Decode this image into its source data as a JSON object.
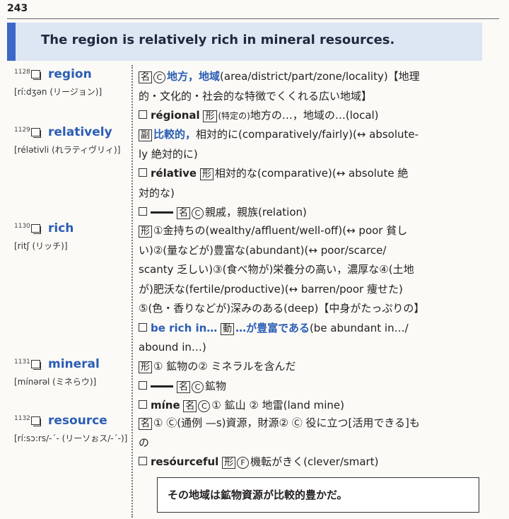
{
  "page_number": "243",
  "banner": {
    "sentence": "The region is relatively rich in mineral resources."
  },
  "example": {
    "sentence": "その地域は鉱物資源が比較的豊かだ。"
  },
  "entries": [
    {
      "num": "1128",
      "word": "region",
      "pron": "[rí:dʒən (リージョン)]",
      "lines": [
        {
          "pos": "名",
          "countable": "C",
          "head": "地方，地域",
          "text": "(area/district/part/zone/locality)【地理"
        },
        {
          "text": "的・文化的・社会的な特徴でくくれる広い地域】"
        },
        {
          "checkbox": true,
          "derived": "régional",
          "pos": "形",
          "note": "(特定の)",
          "text": "地方の…，地域の…(local)"
        }
      ]
    },
    {
      "num": "1129",
      "word": "relatively",
      "pron": "[rélətivli (れラティヴリィ)]",
      "lines": [
        {
          "pos": "副",
          "head": "比較的，",
          "text": "相対的に(comparatively/fairly)(↔ absolute-"
        },
        {
          "text": "ly 絶対的に)"
        },
        {
          "checkbox": true,
          "derived": "rélative",
          "pos": "形",
          "text": "相対的な(comparative)(↔ absolute 絶"
        },
        {
          "text": "対的な)"
        },
        {
          "checkbox": true,
          "dash": true,
          "pos": "名",
          "countable": "C",
          "text": "親戚，親族(relation)"
        }
      ]
    },
    {
      "num": "1130",
      "word": "rich",
      "pron": "[ritʃ (リッチ)]",
      "lines": [
        {
          "pos": "形",
          "text": "①金持ちの(wealthy/affluent/well-off)(↔ poor 貧し"
        },
        {
          "text": "い)②(量などが)豊富な(abundant)(↔ poor/scarce/"
        },
        {
          "text": "scanty 乏しい)③(食べ物が)栄養分の高い，濃厚な④(土地"
        },
        {
          "text": "が)肥沃な(fertile/productive)(↔ barren/poor 痩せた)"
        },
        {
          "text": "⑤(色・香りなどが)深みのある(deep)【中身がたっぷりの】"
        },
        {
          "checkbox": true,
          "phrase": "be rich in…",
          "pos": "動",
          "phrase_ja": "…が豊富である",
          "text": "(be abundant in…/"
        },
        {
          "text": "abound in…)"
        }
      ]
    },
    {
      "num": "1131",
      "word": "mineral",
      "pron": "[mínərəl (ミネらウ)]",
      "lines": [
        {
          "pos": "形",
          "text": "① 鉱物の② ミネラルを含んだ"
        },
        {
          "checkbox": true,
          "dash": true,
          "pos": "名",
          "countable": "C",
          "text": "鉱物"
        },
        {
          "checkbox": true,
          "derived": "míne",
          "pos": "名",
          "countable": "C",
          "text": "① 鉱山 ② 地雷(land mine)"
        }
      ]
    },
    {
      "num": "1132",
      "word": "resource",
      "pron": "[rí:sɔ:rs/-ˊ- (リーソぉス/-ˊ-)]",
      "lines": [
        {
          "pos": "名",
          "text": "① Ⓒ(通例 —s)資源，財源② Ⓒ 役に立つ[活用できる]も"
        },
        {
          "text": "の"
        },
        {
          "checkbox": true,
          "derived": "resóurceful",
          "pos": "形",
          "countable": "F",
          "text": "機転がきく(clever/smart)"
        }
      ]
    }
  ]
}
